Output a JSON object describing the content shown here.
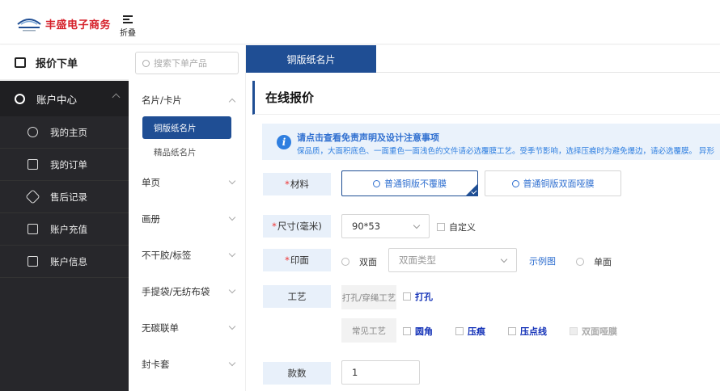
{
  "header": {
    "brand": "丰盛电子商务",
    "fold_label": "折叠"
  },
  "nav": {
    "quote_label": "报价下单",
    "account_center": "账户中心",
    "items": [
      {
        "label": "我的主页",
        "icon": "user-icon"
      },
      {
        "label": "我的订单",
        "icon": "clipboard-icon"
      },
      {
        "label": "售后记录",
        "icon": "tag-icon"
      },
      {
        "label": "账户充值",
        "icon": "wallet-icon"
      },
      {
        "label": "账户信息",
        "icon": "profile-card-icon"
      }
    ]
  },
  "categories": {
    "search_placeholder": "搜索下单产品",
    "groups": [
      "名片/卡片",
      "单页",
      "画册",
      "不干胶/标签",
      "手提袋/无纺布袋",
      "无碳联单",
      "封卡套"
    ],
    "active_sub": "铜版纸名片",
    "sub_item": "精品纸名片"
  },
  "tab": {
    "active_label": "铜版纸名片"
  },
  "main": {
    "title": "在线报价",
    "notice_title": "请点击查看免责声明及设计注意事项",
    "notice_text": "保品质，大面积底色、一面重色一面浅色的文件请必选覆膜工艺。受季节影响，选择压痕时为避免爆边，请必选覆膜。  异形",
    "material_label": "材料",
    "material_options": [
      "普通铜版不覆膜",
      "普通铜版双面哑膜"
    ],
    "size_label": "尺寸(毫米)",
    "size_value": "90*53",
    "custom_label": "自定义",
    "print_label": "印面",
    "double_label": "双面",
    "double_type_placeholder": "双面类型",
    "example_link": "示例图",
    "single_label": "单面",
    "craft_label": "工艺",
    "craft_group1": "打孔/穿绳工艺",
    "craft_punch": "打孔",
    "craft_group2": "常见工艺",
    "craft_options": [
      "圆角",
      "压痕",
      "压点线",
      "双面哑膜"
    ],
    "qty_label": "款数",
    "qty_value": "1"
  }
}
